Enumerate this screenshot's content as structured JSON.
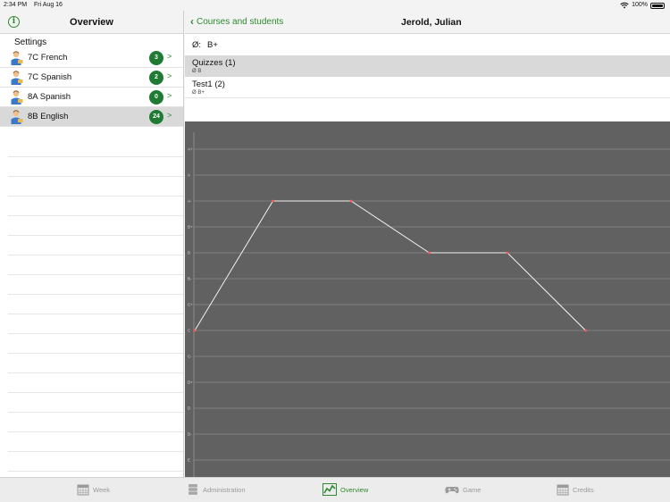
{
  "status": {
    "time": "2:34 PM",
    "date": "Fri Aug 16",
    "battery": "100%"
  },
  "left": {
    "title": "Overview",
    "settings_label": "Settings",
    "courses": [
      {
        "name": "7C French",
        "count": "3",
        "selected": false
      },
      {
        "name": "7C Spanish",
        "count": "2",
        "selected": false
      },
      {
        "name": "8A Spanish",
        "count": "0",
        "selected": false
      },
      {
        "name": "8B English",
        "count": "24",
        "selected": true
      }
    ],
    "chevron": ">"
  },
  "right": {
    "back_label": "Courses and students",
    "title": "Jerold, Julian",
    "average_symbol": "Ø:",
    "average_value": "B+",
    "group": {
      "title": "Quizzes (1)",
      "subtitle": "Ø B"
    },
    "entry": {
      "title": "Test1 (2)",
      "subtitle": "Ø B+"
    }
  },
  "chart_data": {
    "type": "line",
    "y_categories": [
      "A+",
      "A",
      "A-",
      "B+",
      "B",
      "B-",
      "C+",
      "C",
      "C-",
      "D+",
      "D",
      "D-",
      "E"
    ],
    "x": [
      1,
      2,
      3,
      4,
      5,
      6
    ],
    "values": [
      "C",
      "A-",
      "A-",
      "B",
      "B",
      "C"
    ],
    "grid": true,
    "colors": {
      "background": "#616161",
      "line": "#f2f2f2",
      "points": "#ff5a5a",
      "grid": "#8a8a8a"
    }
  },
  "tabs": [
    {
      "label": "Week",
      "icon": "calendar-icon",
      "active": false
    },
    {
      "label": "Administration",
      "icon": "database-icon",
      "active": false
    },
    {
      "label": "Overview",
      "icon": "chart-icon",
      "active": true
    },
    {
      "label": "Game",
      "icon": "gamepad-icon",
      "active": false
    },
    {
      "label": "Credits",
      "icon": "credits-icon",
      "active": false
    }
  ],
  "colors": {
    "accent": "#2f8a2f",
    "badge": "#1f7a33",
    "selected_row": "#d9d9d9"
  }
}
